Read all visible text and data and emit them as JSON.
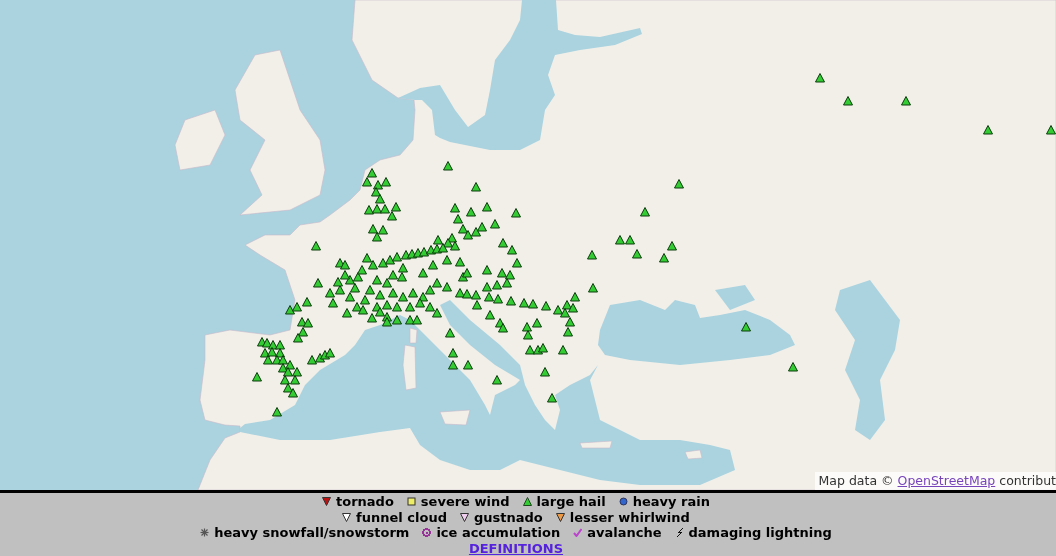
{
  "map": {
    "attribution": {
      "prefix": "Map data ©",
      "link": "OpenStreetMap",
      "suffix": "contribut"
    }
  },
  "legend": {
    "rows": [
      [
        {
          "kind": "tornado",
          "label": "tornado",
          "color": "#bb1111"
        },
        {
          "kind": "severe_wind",
          "label": "severe wind",
          "color": "#eeee66"
        },
        {
          "kind": "large_hail",
          "label": "large hail",
          "color": "#33cc33"
        },
        {
          "kind": "heavy_rain",
          "label": "heavy rain",
          "color": "#3366cc"
        }
      ],
      [
        {
          "kind": "funnel_cloud",
          "label": "funnel cloud",
          "color": "#ffffff"
        },
        {
          "kind": "gustnado",
          "label": "gustnado",
          "color": "#eeccee"
        },
        {
          "kind": "lesser_whirlwind",
          "label": "lesser whirlwind",
          "color": "#ee9944"
        }
      ],
      [
        {
          "kind": "heavy_snowfall",
          "label": "heavy snowfall/snowstorm",
          "color": "#555555"
        },
        {
          "kind": "ice_accumulation",
          "label": "ice accumulation",
          "color": "#993399"
        },
        {
          "kind": "avalanche",
          "label": "avalanche",
          "color": "#bb44cc"
        },
        {
          "kind": "damaging_lightning",
          "label": "damaging lightning",
          "color": "#111111"
        }
      ]
    ],
    "definitions_link": "DEFINITIONS"
  }
}
